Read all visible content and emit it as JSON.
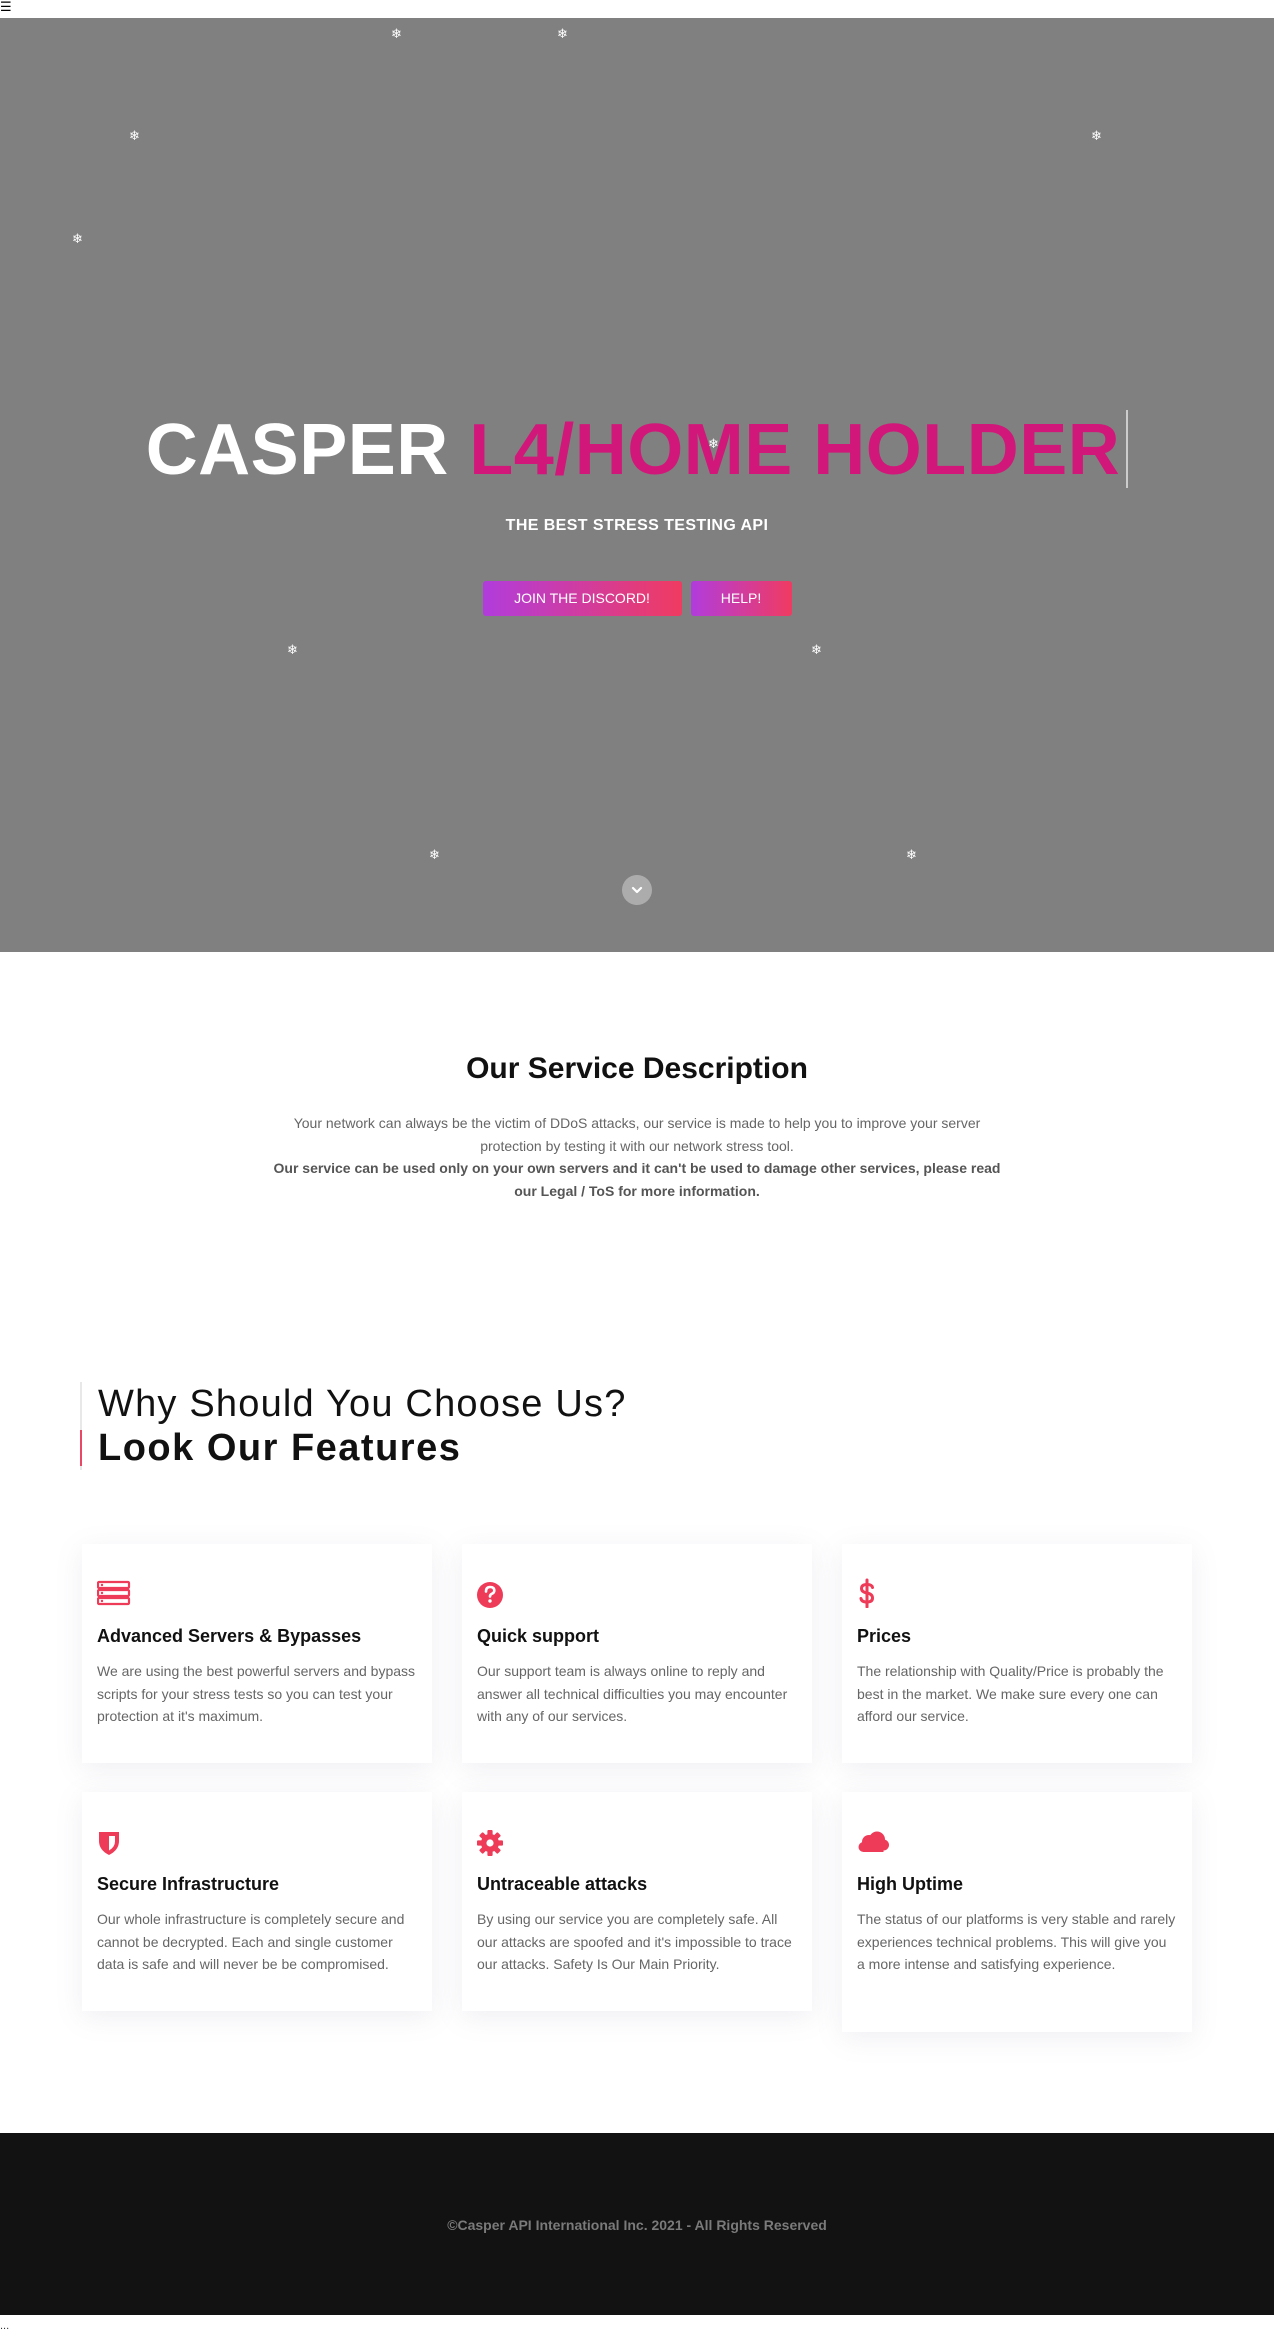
{
  "nav": {
    "menu_icon": "hamburger-icon"
  },
  "hero": {
    "title_white": "CASPER",
    "title_pink": "L4/HOME HOLDER",
    "subtitle": "THE BEST STRESS TESTING API",
    "buttons": [
      {
        "label": "JOIN THE DISCORD!"
      },
      {
        "label": "HELP!"
      }
    ],
    "snowflake_glyph": "❄",
    "background_color": "#808080",
    "accent_color": "#d1177a"
  },
  "service": {
    "title_prefix": "Our",
    "title_bold": "Service",
    "title_suffix": "Description",
    "description": "Your network can always be the victim of DDoS attacks, our service is made to help you to improve your server protection by testing it with our network stress tool.",
    "notice": "Our service can be used only on your own servers and it can't be used to damage other services, please read our Legal / ToS for more information."
  },
  "features": {
    "heading_line1": "Why Should You Choose Us?",
    "heading_line2": "Look Our Features",
    "items": [
      {
        "icon": "server-icon",
        "title": "Advanced Servers & Bypasses",
        "text": "We are using the best powerful servers and bypass scripts for your stress tests so you can test your protection at it's maximum."
      },
      {
        "icon": "question-icon",
        "title": "Quick support",
        "text": "Our support team is always online to reply and answer all technical difficulties you may encounter with any of our services."
      },
      {
        "icon": "dollar-icon",
        "title": "Prices",
        "text": "The relationship with Quality/Price is probably the best in the market. We make sure every one can afford our service."
      },
      {
        "icon": "shield-icon",
        "title": "Secure Infrastructure",
        "text": "Our whole infrastructure is completely secure and cannot be decrypted. Each and single customer data is safe and will never be be compromised."
      },
      {
        "icon": "gear-icon",
        "title": "Untraceable attacks",
        "text": "By using our service you are completely safe. All our attacks are spoofed and it's impossible to trace our attacks. Safety Is Our Main Priority."
      },
      {
        "icon": "cloud-icon",
        "title": "High Uptime",
        "text": "The status of our platforms is very stable and rarely experiences technical problems. This will give you a more intense and satisfying experience."
      }
    ],
    "icon_color": "#ee3b58"
  },
  "footer": {
    "copyright": "©Casper API International Inc. 2021 - All Rights Reserved"
  },
  "bottom_mark": "..."
}
